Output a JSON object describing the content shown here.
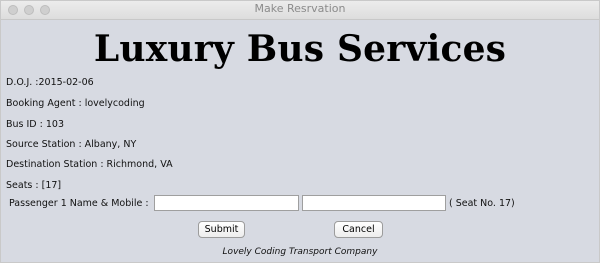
{
  "window": {
    "title": "Make Resrvation"
  },
  "app": {
    "heading": "Luxury Bus Services",
    "footer": "Lovely Coding Transport Company"
  },
  "details": {
    "doj": "D.O.J. :2015-02-06",
    "agent": "Booking Agent : lovelycoding",
    "bus_id": "Bus ID : 103",
    "source": "Source Station : Albany, NY",
    "destination": "Destination Station : Richmond, VA",
    "seats": "Seats : [17]"
  },
  "passenger": {
    "label": "Passenger 1 Name & Mobile :",
    "name_value": "",
    "mobile_value": "",
    "seat_note": "( Seat No. 17)"
  },
  "buttons": {
    "submit": "Submit",
    "cancel": "Cancel"
  }
}
